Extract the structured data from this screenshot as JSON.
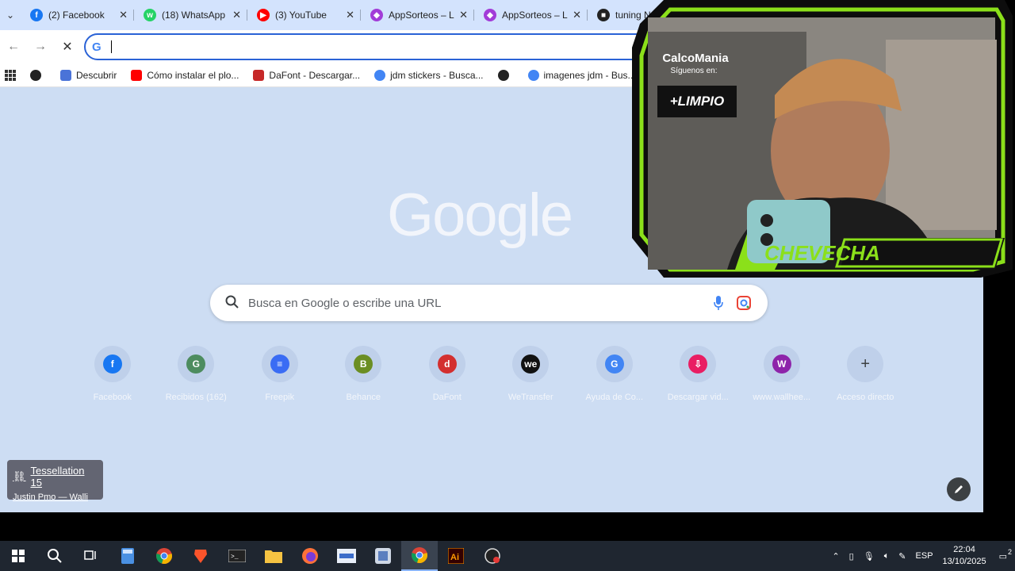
{
  "tabs": [
    {
      "title": "(2) Facebook",
      "color": "#1877f2",
      "glyph": "f"
    },
    {
      "title": "(18) WhatsApp",
      "color": "#25d366",
      "glyph": "w"
    },
    {
      "title": "(3) YouTube",
      "color": "#ff0000",
      "glyph": "▶"
    },
    {
      "title": "AppSorteos – L",
      "color": "#a23cd8",
      "glyph": "◆"
    },
    {
      "title": "AppSorteos – L",
      "color": "#a23cd8",
      "glyph": "◆"
    },
    {
      "title": "tuning N",
      "color": "#222222",
      "glyph": "■"
    }
  ],
  "tab_close": "✕",
  "bookmarks": [
    {
      "label": "",
      "icon": "globe-icon"
    },
    {
      "label": "Descubrir",
      "icon": "discover-icon"
    },
    {
      "label": "Cómo instalar el plo...",
      "icon": "youtube-icon"
    },
    {
      "label": "DaFont - Descargar...",
      "icon": "dafont-icon"
    },
    {
      "label": "jdm stickers - Busca...",
      "icon": "google-icon"
    },
    {
      "label": "",
      "icon": "globe-icon"
    },
    {
      "label": "imagenes jdm - Bus...",
      "icon": "google-icon"
    },
    {
      "label": "",
      "icon": "facebook-icon"
    }
  ],
  "logo": "Google",
  "search": {
    "placeholder": "Busca en Google o escribe una URL"
  },
  "shortcuts": [
    {
      "label": "Facebook",
      "glyph": "f",
      "color": "#1877f2"
    },
    {
      "label": "Recibidos (162)",
      "glyph": "G",
      "color": "#4d8c5f"
    },
    {
      "label": "Freepik",
      "glyph": "≡",
      "color": "#3a6cf4"
    },
    {
      "label": "Behance",
      "glyph": "B",
      "color": "#6b8e23"
    },
    {
      "label": "DaFont",
      "glyph": "d",
      "color": "#d32f2f"
    },
    {
      "label": "WeTransfer",
      "glyph": "we",
      "color": "#111111"
    },
    {
      "label": "Ayuda de Co...",
      "glyph": "G",
      "color": "#4285f4"
    },
    {
      "label": "Descargar vid...",
      "glyph": "⇩",
      "color": "#e91e63"
    },
    {
      "label": "www.wallhee...",
      "glyph": "W",
      "color": "#8e24aa"
    },
    {
      "label": "Acceso directo",
      "glyph": "+",
      "color": "#5f6368"
    }
  ],
  "toast": {
    "title": "Tessellation 15",
    "subtitle": "Justin Pmo — Walli"
  },
  "overlay": {
    "brand": "CalcoMania",
    "follow": "Síguenos en:",
    "sponsor": "+LIMPIO",
    "name": "CHEVECHA"
  },
  "taskbar": {
    "lang": "ESP",
    "time": "22:04",
    "date": "13/10/2025",
    "notifications": "2"
  }
}
